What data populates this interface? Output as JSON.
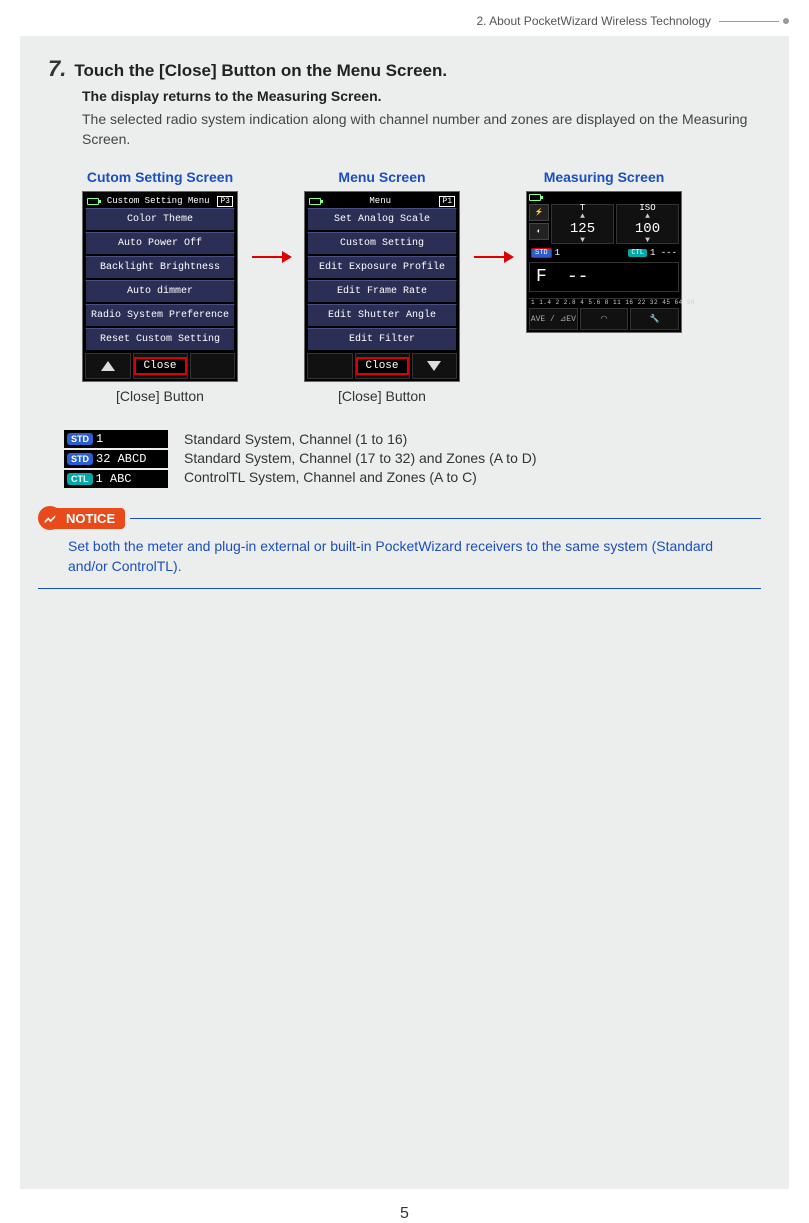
{
  "header": {
    "section": "2.  About PocketWizard Wireless Technology"
  },
  "step": {
    "number": "7.",
    "title": "Touch the [Close] Button on the Menu Screen.",
    "subtitle": "The display returns to the Measuring Screen.",
    "body": "The selected radio system indication along with channel number and zones are displayed on the Measuring Screen."
  },
  "screens": {
    "custom": {
      "label": "Cutom Setting Screen",
      "title": "Custom Setting Menu",
      "page": "P3",
      "items": [
        "Color Theme",
        "Auto Power Off",
        "Backlight Brightness",
        "Auto dimmer",
        "Radio System Preference",
        "Reset Custom Setting"
      ],
      "close": "Close",
      "caption": "[Close] Button"
    },
    "menu": {
      "label": "Menu Screen",
      "title": "Menu",
      "page": "P1",
      "items": [
        "Set Analog Scale",
        "Custom Setting",
        "Edit Exposure Profile",
        "Edit Frame Rate",
        "Edit Shutter Angle",
        "Edit Filter"
      ],
      "close": "Close",
      "caption": "[Close] Button"
    },
    "measuring": {
      "label": "Measuring Screen",
      "t_label": "T",
      "t_value": "125",
      "iso_label": "ISO",
      "iso_value": "100",
      "std": "STD",
      "std_val": "1",
      "ctl": "CTL",
      "ctl_val": "1 ---",
      "f_label": "F",
      "f_value": "--",
      "scale": "1 1.4 2 2.8 4 5.6 8 11 16 22 32 45 64 90",
      "ave": "AVE /",
      "ev": "⊿EV"
    }
  },
  "legend": {
    "rows": [
      {
        "tag": "STD",
        "tagClass": "std",
        "text": "1",
        "desc": "Standard System, Channel (1 to 16)"
      },
      {
        "tag": "STD",
        "tagClass": "std",
        "text": "32 ABCD",
        "desc": "Standard System, Channel (17 to 32) and Zones (A to D)"
      },
      {
        "tag": "CTL",
        "tagClass": "ctl",
        "text": "1 ABC",
        "desc": "ControlTL System, Channel and Zones (A to C)"
      }
    ]
  },
  "notice": {
    "label": "NOTICE",
    "body": "Set both the meter and plug-in external or built-in PocketWizard receivers to the same system (Standard and/or ControlTL)."
  },
  "page_number": "5"
}
